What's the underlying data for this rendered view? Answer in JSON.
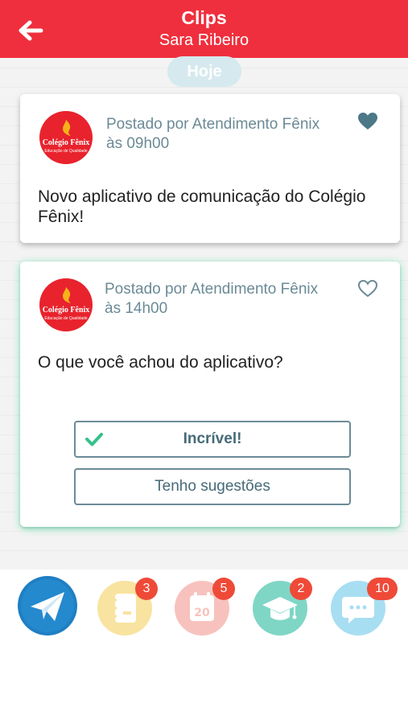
{
  "header": {
    "title": "Clips",
    "subtitle": "Sara Ribeiro",
    "back_icon": "back-arrow-icon"
  },
  "date_separator": "Hoje",
  "logo": {
    "name": "Colégio Fênix",
    "tagline": "Educação de Qualidade"
  },
  "posts": [
    {
      "posted_by": "Postado por Atendimento Fênix",
      "time": "às 09h00",
      "message": "Novo aplicativo de comunicação do Colégio Fênix!",
      "liked": true
    },
    {
      "posted_by": "Postado por Atendimento Fênix",
      "time": "às 14h00",
      "message": "O que você achou do aplicativo?",
      "liked": false,
      "options": [
        {
          "label": "Incrível!",
          "selected": true
        },
        {
          "label": "Tenho sugestões",
          "selected": false
        }
      ]
    }
  ],
  "bottom_nav": [
    {
      "name": "clips",
      "icon": "paper-plane-icon",
      "badge": null,
      "color": "#1f7fc4"
    },
    {
      "name": "notes",
      "icon": "notebook-icon",
      "badge": "3",
      "color": "#f9e3a0"
    },
    {
      "name": "agenda",
      "icon": "calendar-icon",
      "badge": "5",
      "calendar_day": "20",
      "color": "#f7c2bd"
    },
    {
      "name": "grades",
      "icon": "graduation-cap-icon",
      "badge": "2",
      "color": "#7fd6c5"
    },
    {
      "name": "chat",
      "icon": "chat-bubble-icon",
      "badge": "10",
      "color": "#a8def2"
    }
  ],
  "colors": {
    "header": "#ef2f3d",
    "accent_green": "#35c28a",
    "muted_text": "#6b8a96",
    "badge": "#ef4a38"
  }
}
